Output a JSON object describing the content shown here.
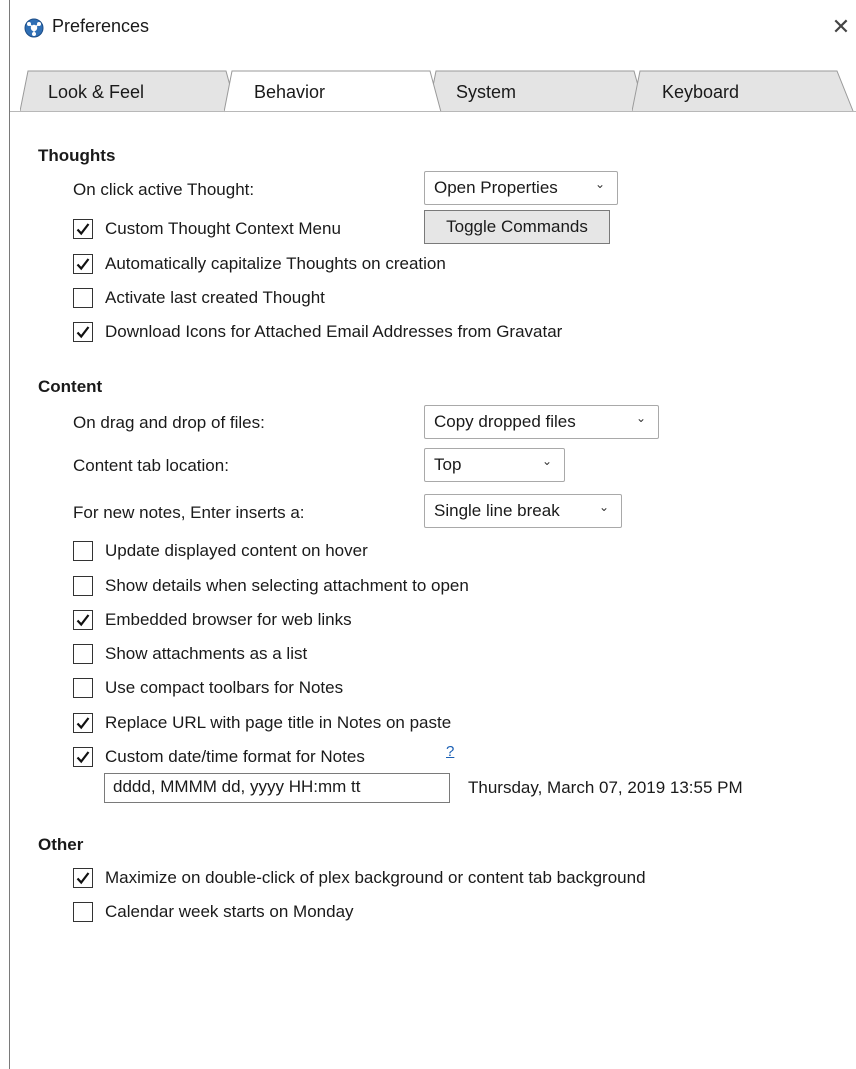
{
  "window": {
    "title": "Preferences",
    "close_glyph": "✕",
    "icon": "app-logo-icon"
  },
  "tabs": [
    {
      "label": "Look & Feel",
      "active": false
    },
    {
      "label": "Behavior",
      "active": true
    },
    {
      "label": "System",
      "active": false
    },
    {
      "label": "Keyboard",
      "active": false
    }
  ],
  "thoughts": {
    "heading": "Thoughts",
    "on_click_label": "On click active Thought:",
    "on_click_value": "Open Properties",
    "custom_menu_label": "Custom Thought Context Menu",
    "custom_menu_checked": true,
    "toggle_button": "Toggle Commands",
    "capitalize_label": "Automatically capitalize Thoughts on creation",
    "capitalize_checked": true,
    "activate_last_label": "Activate last created Thought",
    "activate_last_checked": false,
    "gravatar_label": "Download Icons for Attached Email Addresses from Gravatar",
    "gravatar_checked": true
  },
  "content": {
    "heading": "Content",
    "drag_drop_label": "On drag and drop of files:",
    "drag_drop_value": "Copy dropped files",
    "tab_location_label": "Content tab location:",
    "tab_location_value": "Top",
    "enter_inserts_label": "For new notes, Enter inserts a:",
    "enter_inserts_value": "Single line break",
    "update_hover_label": "Update displayed content on hover",
    "update_hover_checked": false,
    "show_details_label": "Show details when selecting attachment to open",
    "show_details_checked": false,
    "embedded_browser_label": "Embedded browser for web links",
    "embedded_browser_checked": true,
    "attachments_list_label": "Show attachments as a list",
    "attachments_list_checked": false,
    "compact_toolbars_label": "Use compact toolbars for Notes",
    "compact_toolbars_checked": false,
    "replace_url_label": "Replace URL with page title in Notes on paste",
    "replace_url_checked": true,
    "custom_date_label": "Custom date/time format for Notes",
    "custom_date_checked": true,
    "help_link": "?",
    "date_format_value": "dddd, MMMM dd, yyyy HH:mm tt",
    "date_preview": "Thursday, March 07, 2019 13:55 PM"
  },
  "other": {
    "heading": "Other",
    "maximize_label": "Maximize on double-click of plex background or content tab background",
    "maximize_checked": true,
    "calendar_label": "Calendar week starts on Monday",
    "calendar_checked": false
  },
  "colors": {
    "accent": "#1a5fb4",
    "tab_active": "#ffffff",
    "tab_inactive": "#e4e4e4"
  }
}
